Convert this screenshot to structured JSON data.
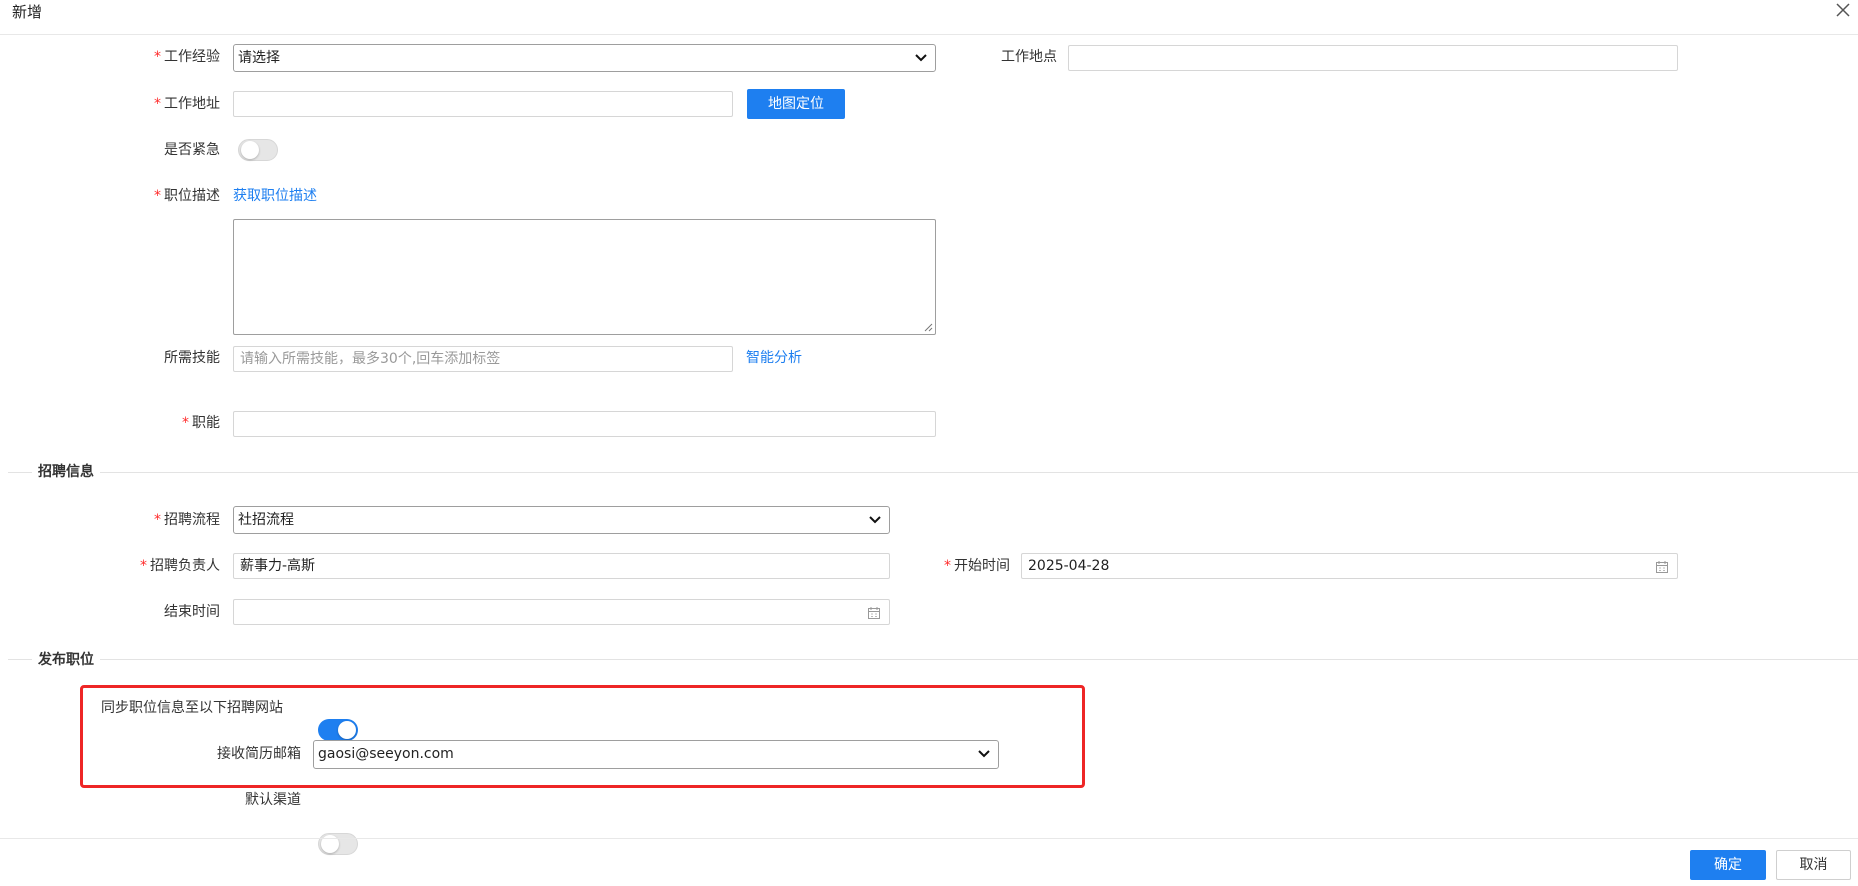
{
  "dialog": {
    "title": "新增"
  },
  "form": {
    "work_experience": {
      "label": "工作经验",
      "value": "请选择"
    },
    "work_location": {
      "label": "工作地点",
      "value": ""
    },
    "work_address": {
      "label": "工作地址",
      "value": "",
      "button": "地图定位"
    },
    "is_urgent": {
      "label": "是否紧急",
      "on": false
    },
    "job_description": {
      "label": "职位描述",
      "link": "获取职位描述",
      "value": ""
    },
    "required_skills": {
      "label": "所需技能",
      "placeholder": "请输入所需技能，最多30个,回车添加标签",
      "link": "智能分析"
    },
    "job_function": {
      "label": "职能",
      "value": ""
    }
  },
  "recruit_section": {
    "title": "招聘信息",
    "process": {
      "label": "招聘流程",
      "value": "社招流程"
    },
    "owner": {
      "label": "招聘负责人",
      "value": "薪事力-高斯"
    },
    "start_time": {
      "label": "开始时间",
      "value": "2025-04-28"
    },
    "end_time": {
      "label": "结束时间",
      "value": ""
    }
  },
  "publish_section": {
    "title": "发布职位",
    "sync": {
      "label": "同步职位信息至以下招聘网站",
      "on": true
    },
    "email": {
      "label": "接收简历邮箱",
      "value": "gaosi@seeyon.com"
    },
    "default_channel": {
      "label": "默认渠道",
      "on": false
    }
  },
  "footer": {
    "confirm": "确定",
    "cancel": "取消"
  },
  "colors": {
    "accent": "#1e7ff0",
    "required": "#ff2a2a",
    "highlight": "#ee2626"
  },
  "icons": [
    "close-icon",
    "chevron-down-icon",
    "calendar-icon",
    "resize-grip-icon"
  ]
}
